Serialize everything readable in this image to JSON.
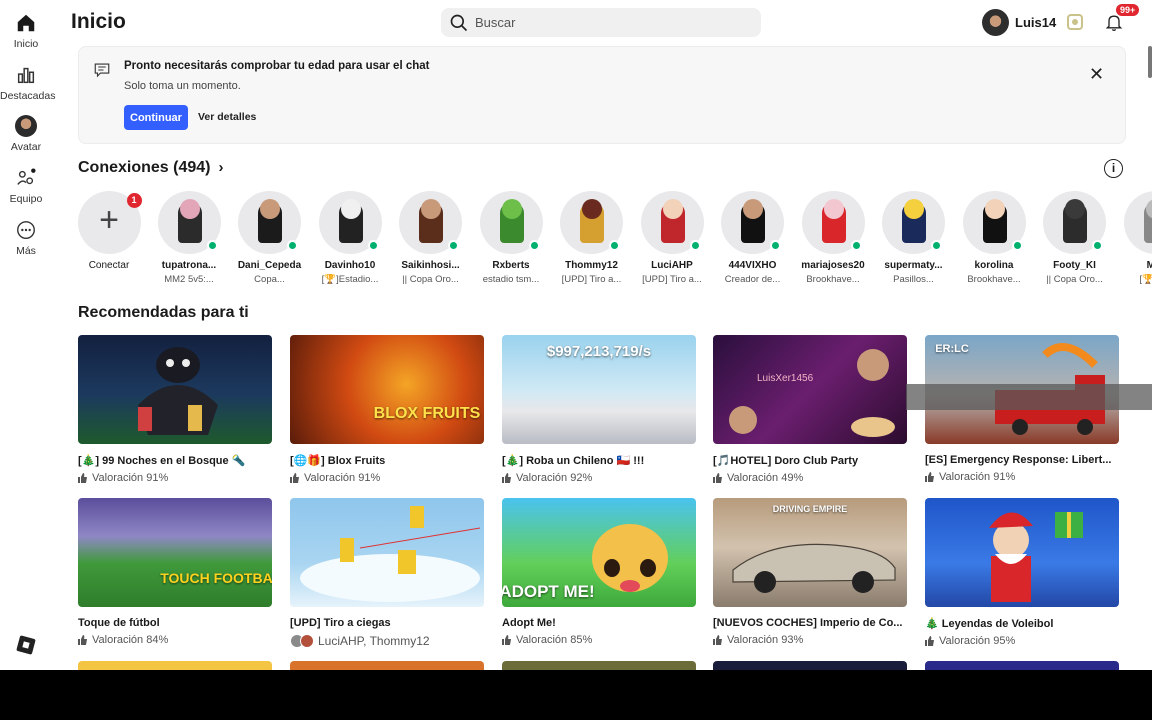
{
  "nav": {
    "items": [
      {
        "label": "Inicio",
        "icon": "home-icon"
      },
      {
        "label": "Destacadas",
        "icon": "charts-icon"
      },
      {
        "label": "Avatar",
        "icon": "avatar-icon"
      },
      {
        "label": "Equipo",
        "icon": "team-icon"
      },
      {
        "label": "Más",
        "icon": "more-icon"
      }
    ]
  },
  "header": {
    "title": "Inicio",
    "search_placeholder": "Buscar",
    "username": "Luis14",
    "notification_count": "99+"
  },
  "banner": {
    "title": "Pronto necesitarás comprobar tu edad para usar el chat",
    "subtitle": "Solo toma un momento.",
    "primary_button": "Continuar",
    "secondary_link": "Ver detalles"
  },
  "connections": {
    "title": "Conexiones (494)",
    "add_label": "Conectar",
    "add_badge": "1",
    "people": [
      {
        "name": "tupatrona...",
        "status": "MM2 5v5:..."
      },
      {
        "name": "Dani_Cepeda",
        "status": "Copa..."
      },
      {
        "name": "Davinho10",
        "status": "[🏆]Estadio..."
      },
      {
        "name": "Saikinhosi...",
        "status": "|| Copa Oro..."
      },
      {
        "name": "Rxberts",
        "status": "estadio tsm..."
      },
      {
        "name": "Thommy12",
        "status": "[UPD] Tiro a..."
      },
      {
        "name": "LuciAHP",
        "status": "[UPD] Tiro a..."
      },
      {
        "name": "444VIXHO",
        "status": "Creador de..."
      },
      {
        "name": "mariajoses20",
        "status": "Brookhave..."
      },
      {
        "name": "supermaty...",
        "status": "Pasillos..."
      },
      {
        "name": "korolina",
        "status": "Brookhave..."
      },
      {
        "name": "Footy_KI",
        "status": "|| Copa Oro..."
      },
      {
        "name": "M...",
        "status": "[🏆]E..."
      }
    ]
  },
  "recommended": {
    "title": "Recomendadas para ti",
    "overlay_user": "LuisXer1456",
    "games": [
      {
        "name": "[🎄] 99 Noches en el Bosque 🔦",
        "rating": "Valoración 91%"
      },
      {
        "name": "[🌐🎁] Blox Fruits",
        "rating": "Valoración 91%",
        "thumb_text": "BLOX FRUITS"
      },
      {
        "name": "[🎄] Roba un Chileno 🇨🇱 !!!",
        "rating": "Valoración 92%",
        "thumb_text": "$997,213,719/s"
      },
      {
        "name": "[🎵HOTEL] Doro Club Party",
        "rating": "Valoración 49%"
      },
      {
        "name": "[ES] Emergency Response: Libert...",
        "rating": "Valoración 91%",
        "thumb_text": "ER:LC"
      },
      {
        "name": "Toque de fútbol",
        "rating": "Valoración 84%",
        "thumb_text": "TOUCH FOOTBALL"
      },
      {
        "name": "[UPD] Tiro a ciegas",
        "friends": "LuciAHP, Thommy12"
      },
      {
        "name": "Adopt Me!",
        "rating": "Valoración 85%",
        "thumb_text": "ADOPT ME!"
      },
      {
        "name": "[NUEVOS COCHES] Imperio de Co...",
        "rating": "Valoración 93%",
        "thumb_text": "DRIVING EMPIRE"
      },
      {
        "name": "🎄 Leyendas de Voleibol",
        "rating": "Valoración 95%"
      }
    ]
  },
  "colors": {
    "primary": "#335fff",
    "online": "#00b06f",
    "badge": "#e0262f"
  }
}
